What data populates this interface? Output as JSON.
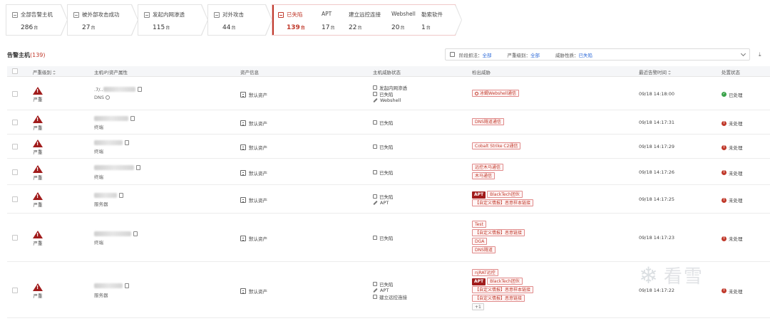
{
  "funnel": {
    "steps": [
      {
        "title": "全部告警主机",
        "count": "286",
        "unit": "台"
      },
      {
        "title": "被外部攻击成功",
        "count": "27",
        "unit": "台"
      },
      {
        "title": "发起内网渗透",
        "count": "115",
        "unit": "台"
      },
      {
        "title": "对外攻击",
        "count": "44",
        "unit": "台"
      },
      {
        "title": "已失陷",
        "count": "139",
        "unit": "台"
      }
    ],
    "substeps": [
      {
        "title": "APT",
        "count": "17",
        "unit": "台"
      },
      {
        "title": "建立远控连接",
        "count": "22",
        "unit": "台"
      },
      {
        "title": "Webshell",
        "count": "20",
        "unit": "台"
      },
      {
        "title": "勒索软件",
        "count": "1",
        "unit": "台"
      }
    ]
  },
  "header": {
    "title": "告警主机",
    "count": "(139)",
    "filters": [
      {
        "label": "阶段抓法：",
        "value": "全部"
      },
      {
        "label": "严重级别：",
        "value": "全部"
      },
      {
        "label": "威胁性质：",
        "value": "已失陷"
      }
    ],
    "download": "⤓"
  },
  "columns": {
    "severity": "严重级别",
    "host": "主机IP/资产属性",
    "asset": "资产信息",
    "threat": "主机威胁状态",
    "detect": "检出威胁",
    "time": "最近告警时间",
    "status": "处置状态"
  },
  "rows": [
    {
      "severity": "严重",
      "ip_text": ".7/..",
      "host_type": "DNS",
      "asset": "默认资产",
      "threats": [
        "发起内网渗透",
        "已失陷",
        "Webshell"
      ],
      "detections": [
        {
          "text": "冰蝎Webshell通信"
        }
      ],
      "time": "09/18 14:18:00",
      "status": "已处理",
      "status_mark": "✓"
    },
    {
      "severity": "严重",
      "ip_text": "",
      "host_type": "终端",
      "asset": "默认资产",
      "threats": [
        "已失陷"
      ],
      "detections": [
        {
          "text": "DNS隧道通信"
        }
      ],
      "time": "09/18 14:17:31",
      "status": "未处理",
      "status_mark": "!"
    },
    {
      "severity": "严重",
      "ip_text": "",
      "host_type": "终端",
      "asset": "默认资产",
      "threats": [
        "已失陷"
      ],
      "detections": [
        {
          "text": "Cobalt Strike C2通信"
        }
      ],
      "time": "09/18 14:17:29",
      "status": "未处理",
      "status_mark": "!"
    },
    {
      "severity": "严重",
      "ip_text": "",
      "host_type": "终端",
      "asset": "默认资产",
      "threats": [
        "已失陷"
      ],
      "detections": [
        {
          "text": "远控木马通信"
        },
        {
          "text": "木马通信"
        }
      ],
      "time": "09/18 14:17:26",
      "status": "未处理",
      "status_mark": "!"
    },
    {
      "severity": "严重",
      "ip_text": "",
      "host_type": "服务器",
      "asset": "默认资产",
      "threats": [
        "已失陷",
        "APT"
      ],
      "detections": [
        {
          "apt": "APT",
          "text": "BlackTech团伙"
        },
        {
          "text": "【自定义情报】恶意样本链接"
        }
      ],
      "time": "09/18 14:17:25",
      "status": "未处理",
      "status_mark": "!"
    },
    {
      "severity": "严重",
      "ip_text": "",
      "host_type": "终端",
      "asset": "默认资产",
      "threats": [
        "已失陷"
      ],
      "detections": [
        {
          "text": "Test"
        },
        {
          "text": "【自定义情报】恶意链接"
        },
        {
          "text": "DGA"
        },
        {
          "text": "DNS隧道"
        }
      ],
      "time": "09/18 14:17:23",
      "status": "未处理",
      "status_mark": "!"
    },
    {
      "severity": "严重",
      "ip_text": "",
      "host_type": "服务器",
      "asset": "默认资产",
      "threats": [
        "已失陷",
        "APT",
        "建立远控连接"
      ],
      "detections": [
        {
          "text": "njRAT远控"
        },
        {
          "apt": "APT",
          "text": "BlackTech团伙"
        },
        {
          "text": "【自定义情报】恶意样本链接"
        },
        {
          "text": "【自定义情报】恶意链接"
        },
        {
          "text": "+1",
          "plain": true
        }
      ],
      "time": "09/18 14:17:22",
      "status": "未处理",
      "status_mark": "!"
    }
  ],
  "watermark": {
    "glyph": "❄",
    "text": "看雪"
  },
  "colors": {
    "accent_red": "#c0392b",
    "dark_red": "#a11c1c",
    "link_blue": "#2f6bd8",
    "ok_green": "#3aa34a"
  }
}
